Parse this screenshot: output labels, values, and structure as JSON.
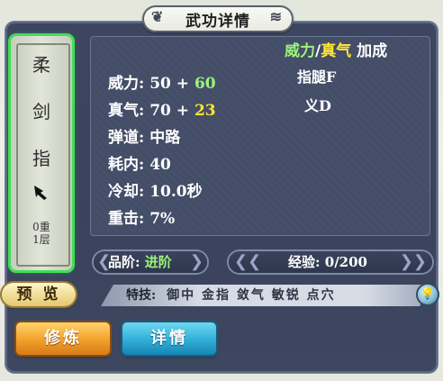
{
  "title": "武功详情",
  "skill_name_chars": [
    "柔",
    "剑",
    "指"
  ],
  "skill_icon": "pointing-hand-icon",
  "grade": {
    "layer_line1": "0重",
    "layer_line2": "1层"
  },
  "stats": {
    "power_label": "威力: 50 + ",
    "power_bonus": "60",
    "qi_label": "真气: 70 + ",
    "qi_bonus": "23",
    "trajectory": "弹道: 中路",
    "cost": "耗内: 40",
    "cooldown": "冷却: 10.0秒",
    "heavy_hit": "重击: 7%"
  },
  "bonus": {
    "header_power": "威力",
    "header_sep": "/",
    "header_qi": "真气",
    "header_suffix": " 加成",
    "line1": "指腿F",
    "line2": "义D"
  },
  "rank": {
    "label": "品阶: ",
    "value": "进阶"
  },
  "exp": {
    "label": "经验: 0/200"
  },
  "preview_button": "预 览",
  "technique": {
    "label": "特技:",
    "skills": "御中 金指 敛气 敏锐 点穴"
  },
  "buttons": {
    "train": "修炼",
    "detail": "详情"
  },
  "colors": {
    "accent_green": "#9cf37a",
    "accent_yellow": "#ffe637",
    "selected_glow": "#3fdf55"
  }
}
